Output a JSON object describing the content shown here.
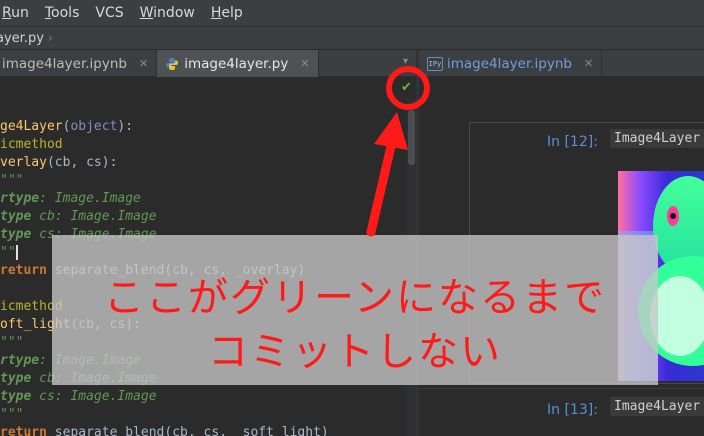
{
  "menubar": {
    "items": [
      {
        "label": "Run",
        "ul": "R",
        "rest": "un"
      },
      {
        "label": "Tools",
        "ul": "T",
        "rest": "ools"
      },
      {
        "label": "VCS",
        "ul": "",
        "rest": "VCS"
      },
      {
        "label": "Window",
        "ul": "W",
        "rest": "indow"
      },
      {
        "label": "Help",
        "ul": "H",
        "rest": "elp"
      }
    ]
  },
  "breadcrumb": {
    "file": "ayer.py"
  },
  "left_tabs": [
    {
      "label": "image4layer.ipynb",
      "active": false
    },
    {
      "label": "image4layer.py",
      "active": true
    }
  ],
  "right_tabs": [
    {
      "label": "image4layer.ipynb",
      "icon_text": "IPy"
    }
  ],
  "editor": {
    "lines": [
      [
        {
          "c": "fn",
          "t": "ge4Layer"
        },
        {
          "c": "txt",
          "t": "("
        },
        {
          "c": "obj",
          "t": "object"
        },
        {
          "c": "txt",
          "t": "):"
        }
      ],
      [
        {
          "c": "dec",
          "t": "icmethod"
        }
      ],
      [
        {
          "c": "fn",
          "t": "verlay"
        },
        {
          "c": "txt",
          "t": "(cb, cs):"
        }
      ],
      [
        {
          "c": "doc",
          "t": "\"\"\""
        }
      ],
      [
        {
          "c": "doctag",
          "t": "rtype"
        },
        {
          "c": "doc",
          "t": ": Image.Image"
        }
      ],
      [
        {
          "c": "doctag",
          "t": "type"
        },
        {
          "c": "doc",
          "t": " cb: Image.Image"
        }
      ],
      [
        {
          "c": "doctag",
          "t": "type"
        },
        {
          "c": "doc",
          "t": " cs: Image.Image"
        }
      ],
      [
        {
          "c": "doc",
          "t": "\"\""
        },
        {
          "c": "cursor",
          "t": ""
        }
      ],
      [
        {
          "c": "kw",
          "t": "return"
        },
        {
          "c": "txt",
          "t": " separate_blend(cb, cs, _overlay)"
        }
      ],
      [
        {
          "c": "txt",
          "t": ""
        }
      ],
      [
        {
          "c": "dec",
          "t": "icmethod"
        }
      ],
      [
        {
          "c": "fn",
          "t": "oft_light"
        },
        {
          "c": "txt",
          "t": "(cb, cs):"
        }
      ],
      [
        {
          "c": "doc",
          "t": "\"\"\""
        }
      ],
      [
        {
          "c": "doctag",
          "t": "rtype"
        },
        {
          "c": "doc",
          "t": ": Image.Image"
        }
      ],
      [
        {
          "c": "doctag",
          "t": "type"
        },
        {
          "c": "doc",
          "t": " cb: Image.Image"
        }
      ],
      [
        {
          "c": "doctag",
          "t": "type"
        },
        {
          "c": "doc",
          "t": " cs: Image.Image"
        }
      ],
      [
        {
          "c": "doc",
          "t": "\"\"\""
        }
      ],
      [
        {
          "c": "kw",
          "t": "return"
        },
        {
          "c": "txt",
          "t": " separate_blend(cb, cs, _soft_light)"
        }
      ]
    ]
  },
  "notebook": {
    "cells": [
      {
        "prompt": "In [12]:",
        "code": "Image4Layer"
      },
      {
        "prompt": "In [13]:",
        "code": "Image4Layer"
      }
    ]
  },
  "annotation": {
    "line1": "ここがグリーンになるまで",
    "line2": "コミットしない",
    "color": "#ff1a1a"
  },
  "colors": {
    "check": "#62b543",
    "prompt": "#5a8fd8"
  }
}
